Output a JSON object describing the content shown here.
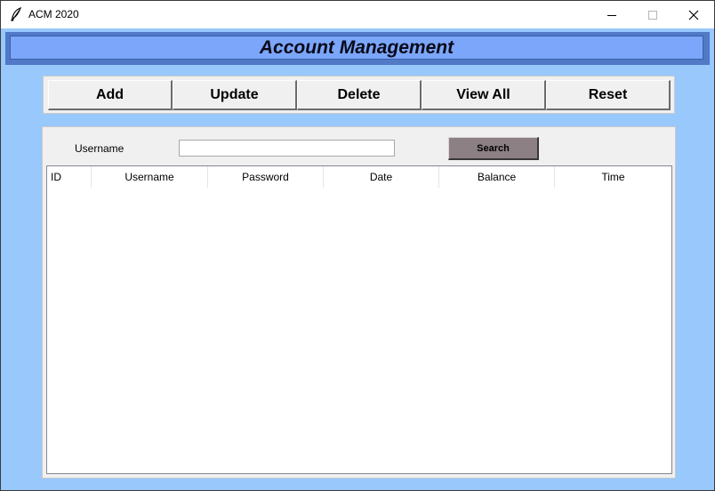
{
  "window": {
    "title": "ACM 2020"
  },
  "banner": {
    "title": "Account Management"
  },
  "toolbar": {
    "buttons": [
      {
        "label": "Add"
      },
      {
        "label": "Update"
      },
      {
        "label": "Delete"
      },
      {
        "label": "View All"
      },
      {
        "label": "Reset"
      }
    ]
  },
  "search": {
    "label": "Username",
    "value": "",
    "button_label": "Search"
  },
  "table": {
    "columns": [
      "ID",
      "Username",
      "Password",
      "Date",
      "Balance",
      "Time"
    ],
    "rows": []
  },
  "colors": {
    "background": "#98c8fc",
    "banner_outer": "#5179c6",
    "banner_inner": "#7ba6f9",
    "search_button": "#8c8084",
    "panel": "#f0f0f0"
  },
  "icons": {
    "app": "feather-icon",
    "minimize": "minimize-icon",
    "maximize": "maximize-icon",
    "close": "close-icon"
  }
}
